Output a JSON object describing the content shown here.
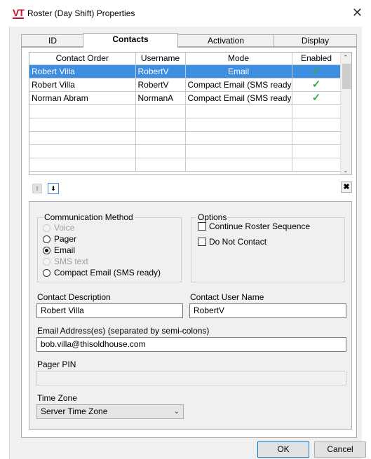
{
  "window": {
    "logo_text": "VT",
    "title": "Roster (Day Shift) Properties",
    "close_glyph": "✕"
  },
  "tabs": [
    {
      "label": "ID"
    },
    {
      "label": "Contacts"
    },
    {
      "label": "Activation"
    },
    {
      "label": "Display"
    }
  ],
  "grid": {
    "columns": [
      "Contact Order",
      "Username",
      "Mode",
      "Enabled"
    ],
    "rows": [
      {
        "contact": "Robert Villa",
        "username": "RobertV",
        "mode": "Email",
        "enabled": "✓"
      },
      {
        "contact": "Robert Villa",
        "username": "RobertV",
        "mode": "Compact Email (SMS ready)",
        "enabled": "✓"
      },
      {
        "contact": "Norman Abram",
        "username": "NormanA",
        "mode": "Compact Email (SMS ready)",
        "enabled": "✓"
      }
    ],
    "selected_row": 0
  },
  "toolbar": {
    "up_glyph": "⬆",
    "down_glyph": "⬇",
    "delete_glyph": "✖"
  },
  "comm_method": {
    "legend": "Communication Method",
    "options": [
      {
        "label": "Voice",
        "state": "disabled"
      },
      {
        "label": "Pager",
        "state": "enabled"
      },
      {
        "label": "Email",
        "state": "checked"
      },
      {
        "label": "SMS text",
        "state": "disabled"
      },
      {
        "label": "Compact Email (SMS ready)",
        "state": "enabled"
      }
    ]
  },
  "options": {
    "legend": "Options",
    "continue_label": "Continue Roster Sequence",
    "do_not_contact_label": "Do Not Contact"
  },
  "fields": {
    "description_label": "Contact Description",
    "description_value": "Robert Villa",
    "username_label": "Contact User Name",
    "username_value": "RobertV",
    "email_label": "Email Address(es) (separated by semi-colons)",
    "email_value": "bob.villa@thisoldhouse.com",
    "pager_label": "Pager PIN",
    "pager_value": "",
    "timezone_label": "Time Zone",
    "timezone_value": "Server Time Zone"
  },
  "buttons": {
    "ok": "OK",
    "cancel": "Cancel"
  },
  "colors": {
    "selection": "#3b8ee2",
    "check": "#33b04a",
    "logo": "#c8102e"
  }
}
